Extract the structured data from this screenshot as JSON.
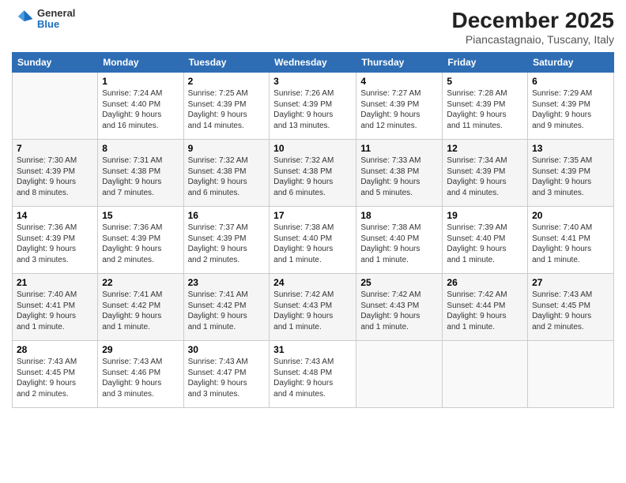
{
  "logo": {
    "general": "General",
    "blue": "Blue"
  },
  "title": "December 2025",
  "location": "Piancastagnaio, Tuscany, Italy",
  "days_header": [
    "Sunday",
    "Monday",
    "Tuesday",
    "Wednesday",
    "Thursday",
    "Friday",
    "Saturday"
  ],
  "weeks": [
    [
      {
        "day": "",
        "info": ""
      },
      {
        "day": "1",
        "info": "Sunrise: 7:24 AM\nSunset: 4:40 PM\nDaylight: 9 hours\nand 16 minutes."
      },
      {
        "day": "2",
        "info": "Sunrise: 7:25 AM\nSunset: 4:39 PM\nDaylight: 9 hours\nand 14 minutes."
      },
      {
        "day": "3",
        "info": "Sunrise: 7:26 AM\nSunset: 4:39 PM\nDaylight: 9 hours\nand 13 minutes."
      },
      {
        "day": "4",
        "info": "Sunrise: 7:27 AM\nSunset: 4:39 PM\nDaylight: 9 hours\nand 12 minutes."
      },
      {
        "day": "5",
        "info": "Sunrise: 7:28 AM\nSunset: 4:39 PM\nDaylight: 9 hours\nand 11 minutes."
      },
      {
        "day": "6",
        "info": "Sunrise: 7:29 AM\nSunset: 4:39 PM\nDaylight: 9 hours\nand 9 minutes."
      }
    ],
    [
      {
        "day": "7",
        "info": "Sunrise: 7:30 AM\nSunset: 4:39 PM\nDaylight: 9 hours\nand 8 minutes."
      },
      {
        "day": "8",
        "info": "Sunrise: 7:31 AM\nSunset: 4:38 PM\nDaylight: 9 hours\nand 7 minutes."
      },
      {
        "day": "9",
        "info": "Sunrise: 7:32 AM\nSunset: 4:38 PM\nDaylight: 9 hours\nand 6 minutes."
      },
      {
        "day": "10",
        "info": "Sunrise: 7:32 AM\nSunset: 4:38 PM\nDaylight: 9 hours\nand 6 minutes."
      },
      {
        "day": "11",
        "info": "Sunrise: 7:33 AM\nSunset: 4:38 PM\nDaylight: 9 hours\nand 5 minutes."
      },
      {
        "day": "12",
        "info": "Sunrise: 7:34 AM\nSunset: 4:39 PM\nDaylight: 9 hours\nand 4 minutes."
      },
      {
        "day": "13",
        "info": "Sunrise: 7:35 AM\nSunset: 4:39 PM\nDaylight: 9 hours\nand 3 minutes."
      }
    ],
    [
      {
        "day": "14",
        "info": "Sunrise: 7:36 AM\nSunset: 4:39 PM\nDaylight: 9 hours\nand 3 minutes."
      },
      {
        "day": "15",
        "info": "Sunrise: 7:36 AM\nSunset: 4:39 PM\nDaylight: 9 hours\nand 2 minutes."
      },
      {
        "day": "16",
        "info": "Sunrise: 7:37 AM\nSunset: 4:39 PM\nDaylight: 9 hours\nand 2 minutes."
      },
      {
        "day": "17",
        "info": "Sunrise: 7:38 AM\nSunset: 4:40 PM\nDaylight: 9 hours\nand 1 minute."
      },
      {
        "day": "18",
        "info": "Sunrise: 7:38 AM\nSunset: 4:40 PM\nDaylight: 9 hours\nand 1 minute."
      },
      {
        "day": "19",
        "info": "Sunrise: 7:39 AM\nSunset: 4:40 PM\nDaylight: 9 hours\nand 1 minute."
      },
      {
        "day": "20",
        "info": "Sunrise: 7:40 AM\nSunset: 4:41 PM\nDaylight: 9 hours\nand 1 minute."
      }
    ],
    [
      {
        "day": "21",
        "info": "Sunrise: 7:40 AM\nSunset: 4:41 PM\nDaylight: 9 hours\nand 1 minute."
      },
      {
        "day": "22",
        "info": "Sunrise: 7:41 AM\nSunset: 4:42 PM\nDaylight: 9 hours\nand 1 minute."
      },
      {
        "day": "23",
        "info": "Sunrise: 7:41 AM\nSunset: 4:42 PM\nDaylight: 9 hours\nand 1 minute."
      },
      {
        "day": "24",
        "info": "Sunrise: 7:42 AM\nSunset: 4:43 PM\nDaylight: 9 hours\nand 1 minute."
      },
      {
        "day": "25",
        "info": "Sunrise: 7:42 AM\nSunset: 4:43 PM\nDaylight: 9 hours\nand 1 minute."
      },
      {
        "day": "26",
        "info": "Sunrise: 7:42 AM\nSunset: 4:44 PM\nDaylight: 9 hours\nand 1 minute."
      },
      {
        "day": "27",
        "info": "Sunrise: 7:43 AM\nSunset: 4:45 PM\nDaylight: 9 hours\nand 2 minutes."
      }
    ],
    [
      {
        "day": "28",
        "info": "Sunrise: 7:43 AM\nSunset: 4:45 PM\nDaylight: 9 hours\nand 2 minutes."
      },
      {
        "day": "29",
        "info": "Sunrise: 7:43 AM\nSunset: 4:46 PM\nDaylight: 9 hours\nand 3 minutes."
      },
      {
        "day": "30",
        "info": "Sunrise: 7:43 AM\nSunset: 4:47 PM\nDaylight: 9 hours\nand 3 minutes."
      },
      {
        "day": "31",
        "info": "Sunrise: 7:43 AM\nSunset: 4:48 PM\nDaylight: 9 hours\nand 4 minutes."
      },
      {
        "day": "",
        "info": ""
      },
      {
        "day": "",
        "info": ""
      },
      {
        "day": "",
        "info": ""
      }
    ]
  ]
}
